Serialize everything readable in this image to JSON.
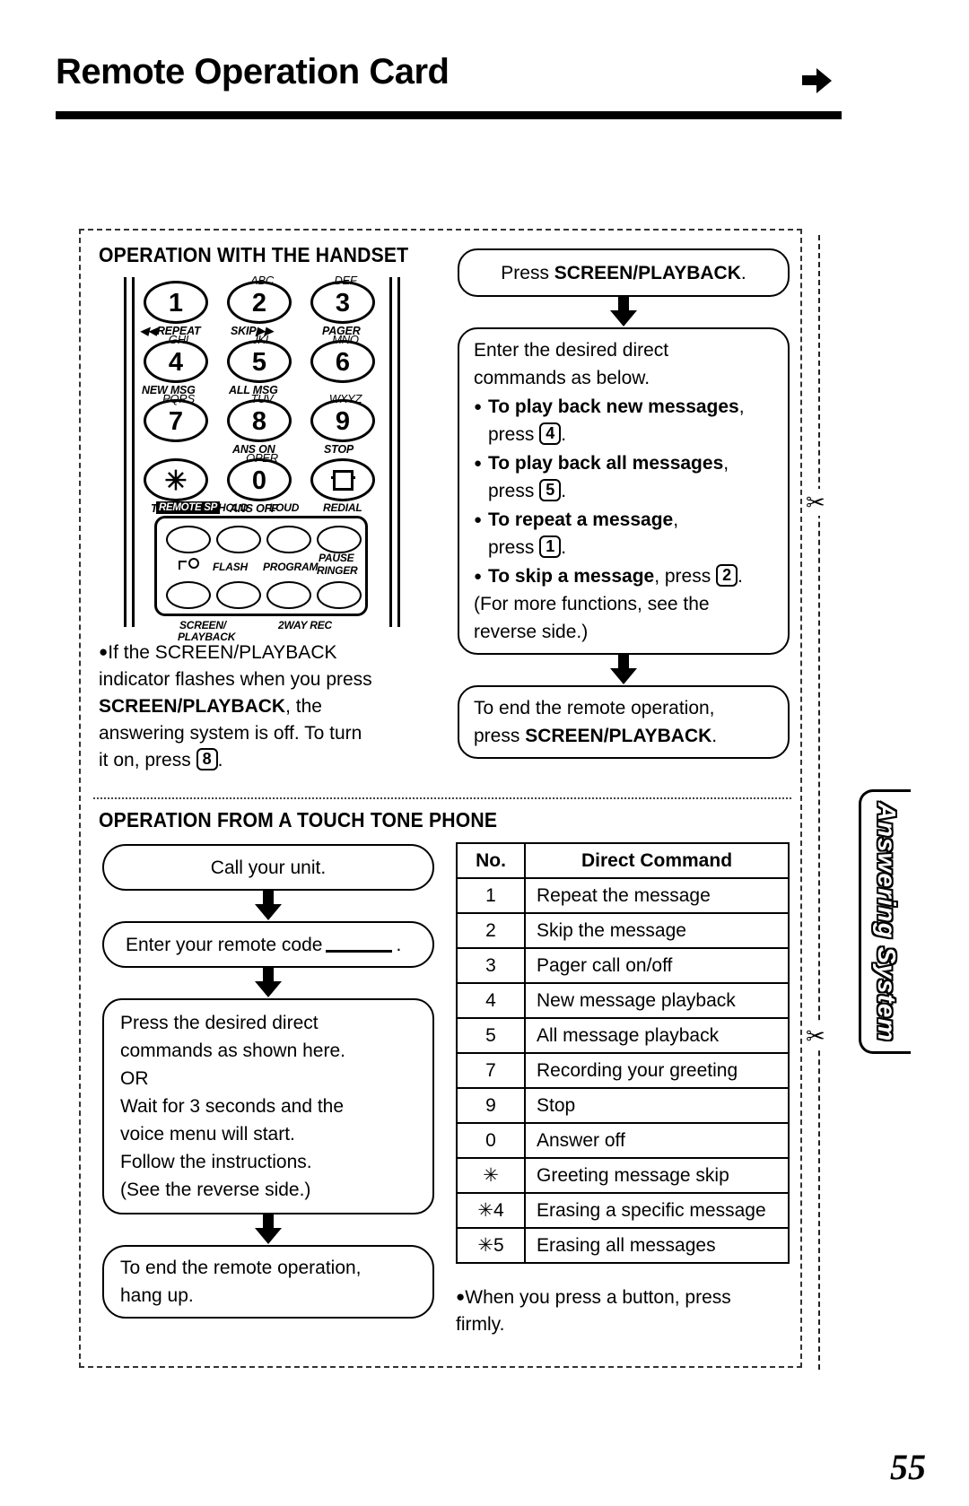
{
  "page": {
    "title": "Remote Operation Card",
    "number": "55",
    "side_tab": "Answering System"
  },
  "handset_section": {
    "heading": "OPERATION WITH THE HANDSET",
    "keypad": {
      "keys": [
        {
          "digit": "1",
          "alpha": "",
          "label_left": "◀◀REPEAT",
          "label_center": ""
        },
        {
          "digit": "2",
          "alpha": "ABC",
          "label_left": "",
          "label_center": "SKIP▶▶"
        },
        {
          "digit": "3",
          "alpha": "DEF",
          "label_left": "",
          "label_center": "PAGER"
        },
        {
          "digit": "4",
          "alpha": "GHI",
          "label_left": "",
          "label_center": "NEW MSG"
        },
        {
          "digit": "5",
          "alpha": "JKL",
          "label_left": "",
          "label_center": "ALL MSG"
        },
        {
          "digit": "6",
          "alpha": "MNO",
          "label_left": "",
          "label_center": ""
        },
        {
          "digit": "7",
          "alpha": "PQRS",
          "label_left": "",
          "label_center": ""
        },
        {
          "digit": "8",
          "alpha": "TUV",
          "label_left": "",
          "label_center": "ANS ON"
        },
        {
          "digit": "9",
          "alpha": "WXYZ",
          "label_left": "",
          "label_center": "STOP"
        },
        {
          "digit": "✳",
          "alpha": "",
          "label_left": "",
          "label_center": "TONE"
        },
        {
          "digit": "0",
          "alpha": "OPER",
          "label_left": "",
          "label_center": "ANS OFF"
        },
        {
          "digit": "#",
          "alpha": "",
          "label_left": "",
          "label_center": ""
        }
      ],
      "function_labels": {
        "remote_sp": "REMOTE SP",
        "hold": "HOLD",
        "loud": "LOUD",
        "redial": "REDIAL",
        "flash": "FLASH",
        "program": "PROGRAM",
        "pause": "PAUSE",
        "ringer": "RINGER",
        "screen": "SCREEN/",
        "playback": "PLAYBACK",
        "two_way_rec": "2WAY REC"
      }
    },
    "note": {
      "lead": "If the SCREEN/PLAYBACK",
      "line2": "indicator flashes when you press",
      "bold1": "SCREEN/PLAYBACK",
      "line3_tail": ", the",
      "line4": "answering system is off. To turn",
      "line5_pre": "it on, press ",
      "line5_key": "8",
      "line5_post": "."
    },
    "flow": {
      "step1_pre": "Press ",
      "step1_bold": "SCREEN/PLAYBACK",
      "step1_post": ".",
      "step2_intro1": "Enter the desired direct",
      "step2_intro2": "commands as below.",
      "step2_items": [
        {
          "bold": "To play back new messages",
          "tail": ",",
          "press_pre": "press ",
          "key": "4",
          "press_post": "."
        },
        {
          "bold": "To play back all messages",
          "tail": ",",
          "press_pre": "press ",
          "key": "5",
          "press_post": "."
        },
        {
          "bold": "To repeat a message",
          "tail": ",",
          "press_pre": "press ",
          "key": "1",
          "press_post": "."
        },
        {
          "bold": "To skip a message",
          "tail": ", press ",
          "press_pre": "",
          "key": "2",
          "press_post": "."
        }
      ],
      "step2_footnote": "(For more functions, see the",
      "step2_footnote2": "reverse side.)",
      "step3_line1": "To end the remote operation,",
      "step3_pre": "press ",
      "step3_bold": "SCREEN/PLAYBACK",
      "step3_post": "."
    }
  },
  "touch_section": {
    "heading": "OPERATION FROM A TOUCH TONE PHONE",
    "flow": {
      "step1": "Call your unit.",
      "step2_pre": "Enter your remote code",
      "step2_post": ".",
      "step3_lines": [
        "Press the desired direct",
        "commands as shown here.",
        "OR",
        "Wait for 3 seconds and the",
        "voice menu will start.",
        "Follow the instructions.",
        "(See the reverse side.)"
      ],
      "step4_line1": "To end the remote operation,",
      "step4_line2": "hang up."
    },
    "table": {
      "headers": [
        "No.",
        "Direct Command"
      ],
      "rows": [
        [
          "1",
          "Repeat the message"
        ],
        [
          "2",
          "Skip the message"
        ],
        [
          "3",
          "Pager call on/off"
        ],
        [
          "4",
          "New message playback"
        ],
        [
          "5",
          "All message playback"
        ],
        [
          "7",
          "Recording your greeting"
        ],
        [
          "9",
          "Stop"
        ],
        [
          "0",
          "Answer off"
        ],
        [
          "✳",
          "Greeting message skip"
        ],
        [
          "✳4",
          "Erasing a specific message"
        ],
        [
          "✳5",
          "Erasing all messages"
        ]
      ]
    },
    "note": {
      "line1": "When you press a button, press",
      "line2": "firmly."
    }
  }
}
